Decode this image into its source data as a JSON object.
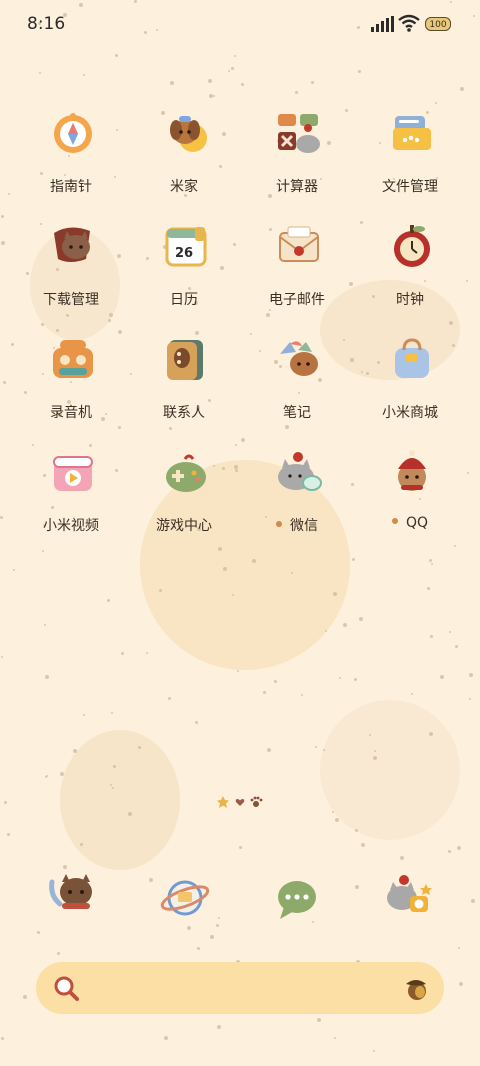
{
  "status_bar": {
    "time": "8:16",
    "battery": "100"
  },
  "apps": [
    {
      "label": "指南针",
      "notify": false,
      "icon": "compass-icon"
    },
    {
      "label": "米家",
      "notify": false,
      "icon": "mihome-icon"
    },
    {
      "label": "计算器",
      "notify": false,
      "icon": "calculator-icon"
    },
    {
      "label": "文件管理",
      "notify": false,
      "icon": "file-manager-icon"
    },
    {
      "label": "下载管理",
      "notify": false,
      "icon": "download-manager-icon"
    },
    {
      "label": "日历",
      "notify": false,
      "icon": "calendar-icon",
      "badge": "26"
    },
    {
      "label": "电子邮件",
      "notify": false,
      "icon": "email-icon"
    },
    {
      "label": "时钟",
      "notify": false,
      "icon": "clock-icon"
    },
    {
      "label": "录音机",
      "notify": false,
      "icon": "recorder-icon"
    },
    {
      "label": "联系人",
      "notify": false,
      "icon": "contacts-icon"
    },
    {
      "label": "笔记",
      "notify": false,
      "icon": "notes-icon"
    },
    {
      "label": "小米商城",
      "notify": false,
      "icon": "mi-store-icon"
    },
    {
      "label": "小米视频",
      "notify": false,
      "icon": "mi-video-icon"
    },
    {
      "label": "游戏中心",
      "notify": false,
      "icon": "game-center-icon"
    },
    {
      "label": "微信",
      "notify": true,
      "icon": "wechat-icon"
    },
    {
      "label": "QQ",
      "notify": true,
      "icon": "qq-icon"
    }
  ],
  "dock": [
    {
      "icon": "phone-cat-icon"
    },
    {
      "icon": "browser-planet-icon"
    },
    {
      "icon": "messages-bubble-icon"
    },
    {
      "icon": "camera-cat-icon"
    }
  ],
  "search": {
    "icon_left": "search-icon",
    "icon_right": "acorn-icon"
  },
  "colors": {
    "background": "#fdf0dc",
    "search_bar": "#fbdfa5",
    "label": "#3a3025"
  }
}
